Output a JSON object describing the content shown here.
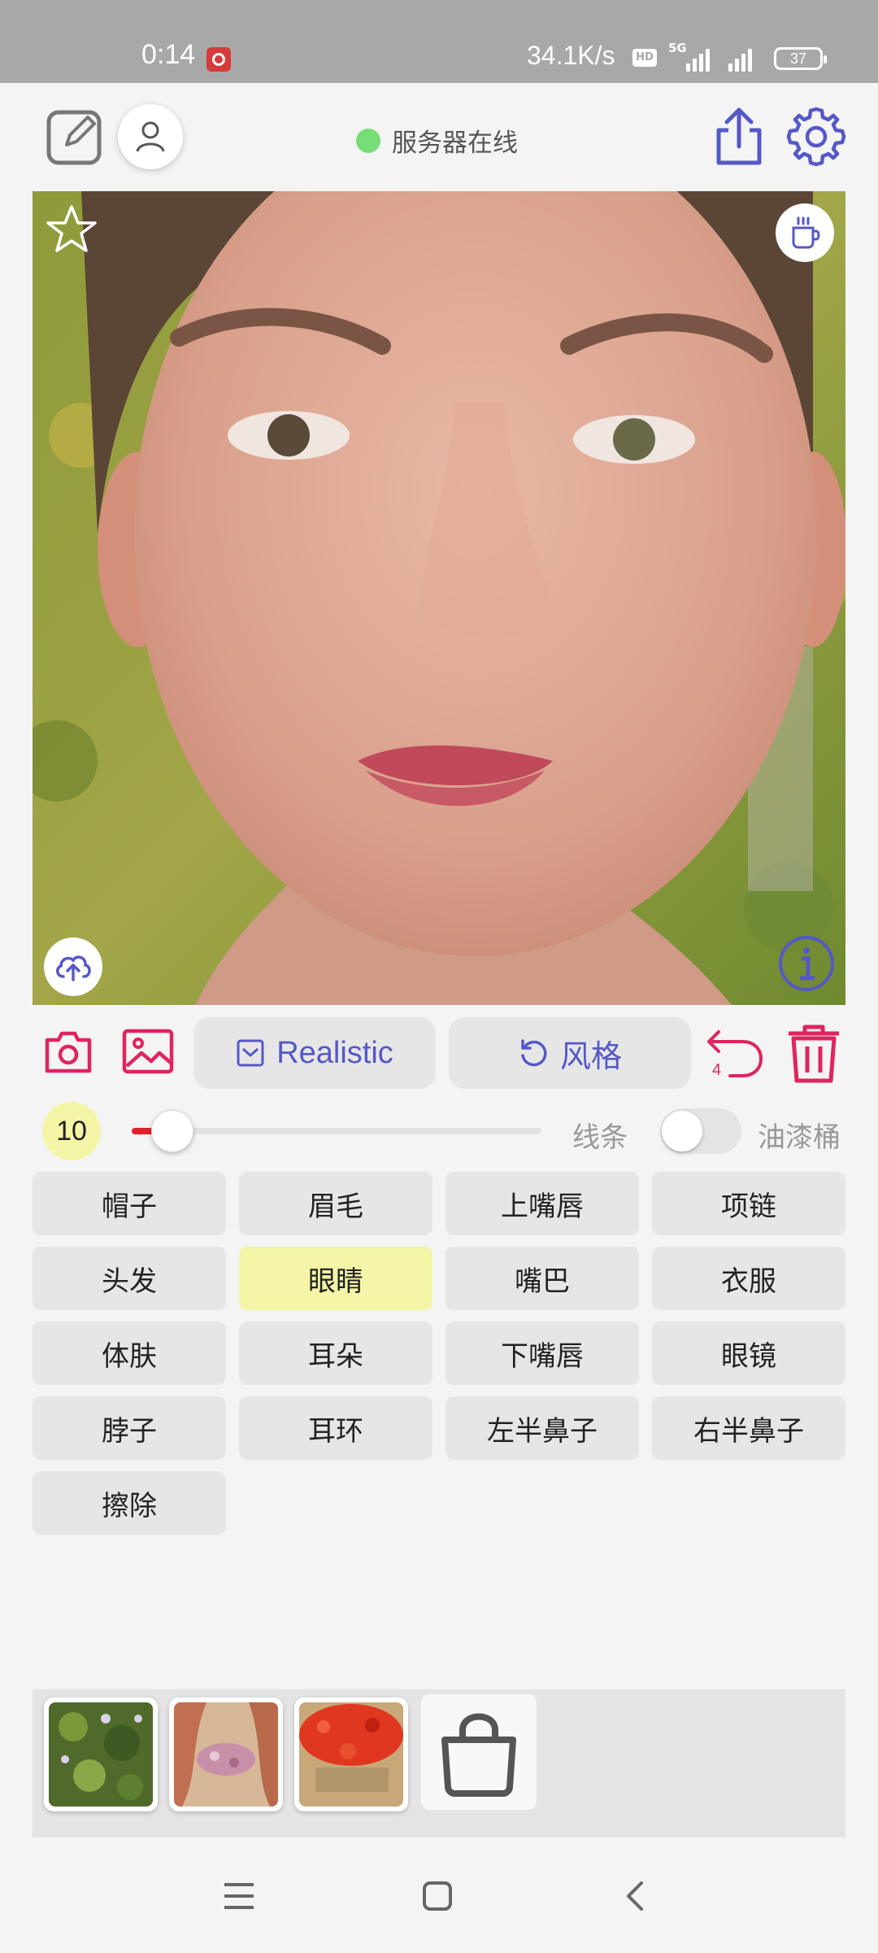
{
  "status_bar": {
    "time": "0:14",
    "net_speed": "34.1K/s",
    "hd": "HD",
    "network": "5G",
    "battery": "37"
  },
  "header": {
    "server_status": "服务器在线",
    "status_color": "#77dd77",
    "icons": [
      "edit-icon",
      "user-icon",
      "share-icon",
      "settings-icon"
    ]
  },
  "canvas": {
    "icons": [
      "star-icon",
      "coffee-cup-icon",
      "cloud-upload-icon",
      "info-icon"
    ]
  },
  "toolbar": {
    "model_label": "Realistic",
    "style_label": "风格",
    "undo_count": "4",
    "accent_color": "#5558c7",
    "danger_color": "#e0245e"
  },
  "brush": {
    "size": "10",
    "size_value": 10,
    "line_label": "线条",
    "fill_label": "油漆桶",
    "fill_enabled": false
  },
  "parts": [
    {
      "label": "帽子"
    },
    {
      "label": "眉毛"
    },
    {
      "label": "上嘴唇"
    },
    {
      "label": "项链"
    },
    {
      "label": "头发"
    },
    {
      "label": "眼睛",
      "selected": true
    },
    {
      "label": "嘴巴"
    },
    {
      "label": "衣服"
    },
    {
      "label": "体肤"
    },
    {
      "label": "耳朵"
    },
    {
      "label": "下嘴唇"
    },
    {
      "label": "眼镜"
    },
    {
      "label": "脖子"
    },
    {
      "label": "耳环"
    },
    {
      "label": "左半鼻子"
    },
    {
      "label": "右半鼻子"
    },
    {
      "label": "擦除"
    }
  ]
}
